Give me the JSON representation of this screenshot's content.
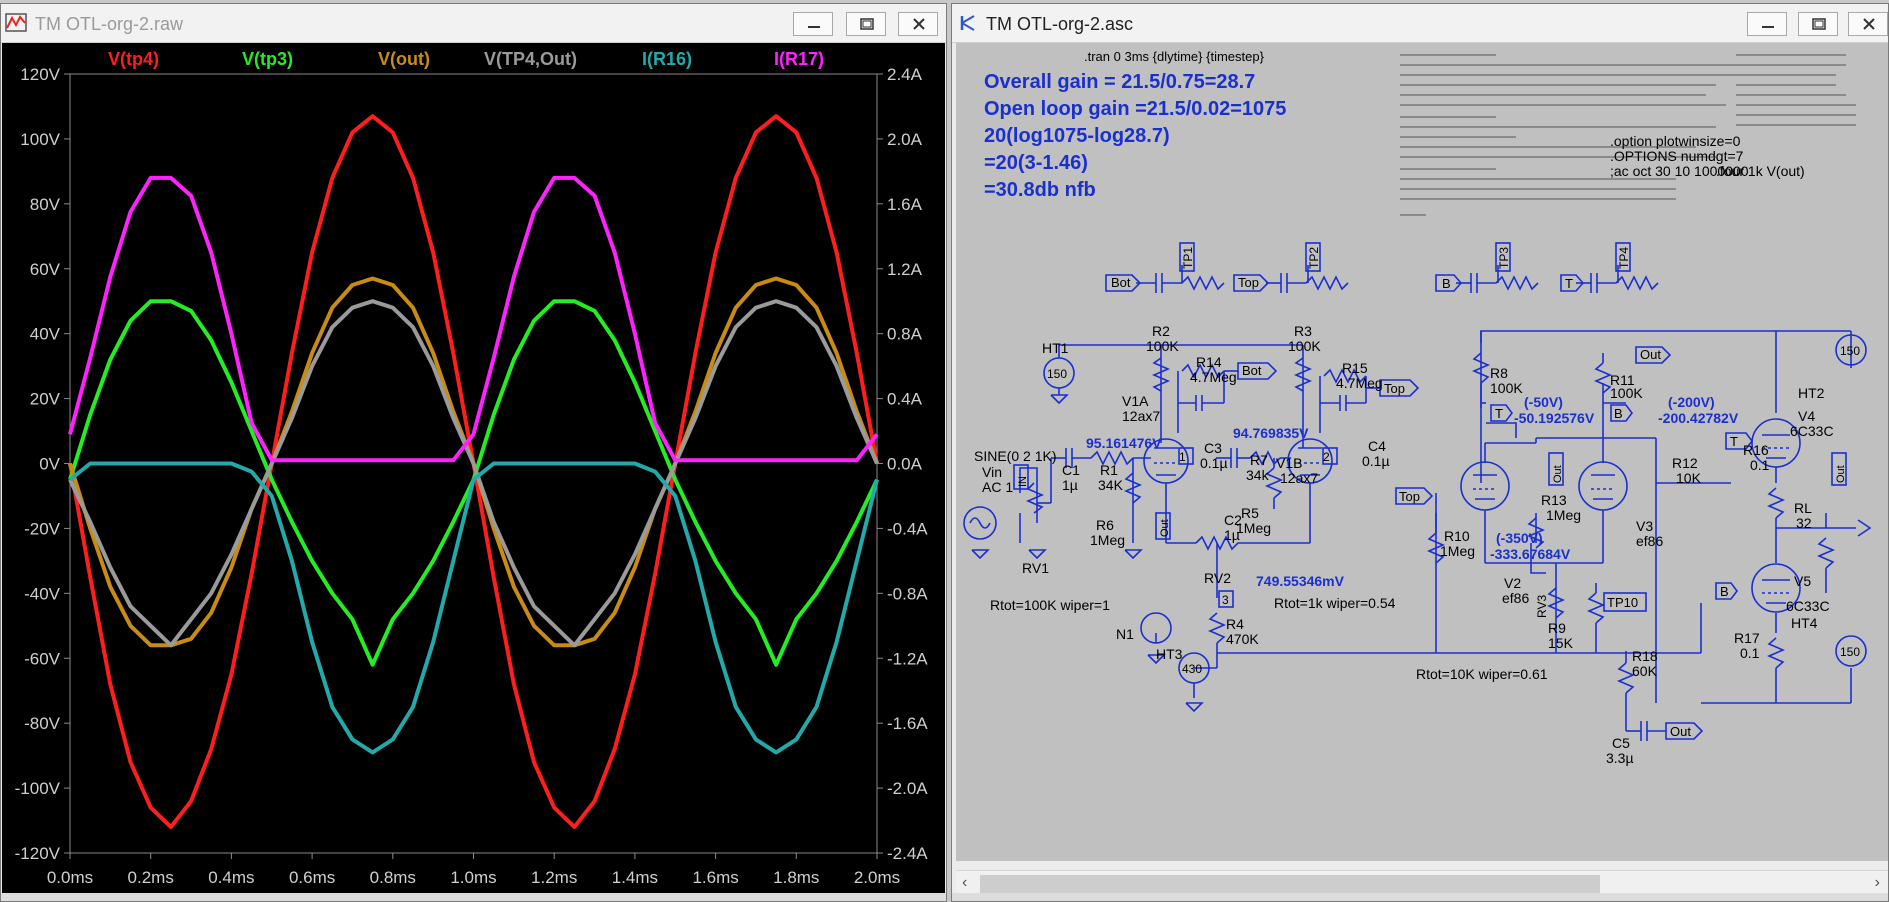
{
  "plot_window": {
    "title": "TM OTL-org-2.raw",
    "legend": [
      {
        "label": "V(tp4)",
        "color": "#ff1e1e"
      },
      {
        "label": "V(tp3)",
        "color": "#22ee22"
      },
      {
        "label": "V(out)",
        "color": "#c98c12"
      },
      {
        "label": "V(TP4,Out)",
        "color": "#9a9a9a"
      },
      {
        "label": "I(R16)",
        "color": "#22aaaa"
      },
      {
        "label": "I(R17)",
        "color": "#ff22ff"
      }
    ]
  },
  "chart_data": {
    "type": "line",
    "title": "",
    "xlabel": "",
    "ylabel": "",
    "xlim": [
      0,
      2.0
    ],
    "ylim": [
      -120,
      120
    ],
    "y2lim": [
      -2.4,
      2.4
    ],
    "grid": false,
    "legend_position": "top",
    "x_ticks": [
      "0.0ms",
      "0.2ms",
      "0.4ms",
      "0.6ms",
      "0.8ms",
      "1.0ms",
      "1.2ms",
      "1.4ms",
      "1.6ms",
      "1.8ms",
      "2.0ms"
    ],
    "y_ticks": [
      "120V",
      "100V",
      "80V",
      "60V",
      "40V",
      "20V",
      "0V",
      "-20V",
      "-40V",
      "-60V",
      "-80V",
      "-100V",
      "-120V"
    ],
    "y2_ticks": [
      "2.4A",
      "2.0A",
      "1.6A",
      "1.2A",
      "0.8A",
      "0.4A",
      "0.0A",
      "-0.4A",
      "-0.8A",
      "-1.2A",
      "-1.6A",
      "-2.0A",
      "-2.4A"
    ],
    "x": [
      0,
      0.05,
      0.1,
      0.15,
      0.2,
      0.25,
      0.3,
      0.35,
      0.4,
      0.45,
      0.5,
      0.55,
      0.6,
      0.65,
      0.7,
      0.75,
      0.8,
      0.85,
      0.9,
      0.95,
      1.0,
      1.05,
      1.1,
      1.15,
      1.2,
      1.25,
      1.3,
      1.35,
      1.4,
      1.45,
      1.5,
      1.55,
      1.6,
      1.65,
      1.7,
      1.75,
      1.8,
      1.85,
      1.9,
      1.95,
      2.0
    ],
    "series": [
      {
        "name": "V(tp4)",
        "axis": "left",
        "color": "#ff1e1e",
        "values": [
          0,
          -35,
          -68,
          -92,
          -106,
          -112,
          -104,
          -88,
          -65,
          -34,
          0,
          34,
          65,
          88,
          102,
          107,
          102,
          88,
          65,
          34,
          0,
          -35,
          -68,
          -92,
          -106,
          -112,
          -104,
          -88,
          -65,
          -34,
          0,
          34,
          65,
          88,
          102,
          107,
          102,
          88,
          65,
          34,
          0
        ]
      },
      {
        "name": "V(tp3)",
        "axis": "left",
        "color": "#22ee22",
        "values": [
          -5,
          15,
          32,
          44,
          50,
          50,
          47,
          38,
          25,
          10,
          -5,
          -18,
          -30,
          -40,
          -48,
          -62,
          -48,
          -40,
          -30,
          -18,
          -5,
          15,
          32,
          44,
          50,
          50,
          47,
          38,
          25,
          10,
          -5,
          -18,
          -30,
          -40,
          -48,
          -62,
          -48,
          -40,
          -30,
          -18,
          -5
        ]
      },
      {
        "name": "V(out)",
        "axis": "left",
        "color": "#c98c12",
        "values": [
          0,
          -20,
          -38,
          -50,
          -56,
          -56,
          -54,
          -46,
          -32,
          -14,
          0,
          16,
          34,
          48,
          55,
          57,
          55,
          48,
          34,
          16,
          0,
          -20,
          -38,
          -50,
          -56,
          -56,
          -54,
          -46,
          -32,
          -14,
          0,
          16,
          34,
          48,
          55,
          57,
          55,
          48,
          34,
          16,
          0
        ]
      },
      {
        "name": "V(TP4,Out)",
        "axis": "left",
        "color": "#9a9a9a",
        "values": [
          -5,
          -18,
          -32,
          -44,
          -50,
          -56,
          -48,
          -40,
          -28,
          -14,
          0,
          14,
          30,
          42,
          48,
          50,
          48,
          42,
          30,
          14,
          0,
          -18,
          -32,
          -44,
          -50,
          -56,
          -48,
          -40,
          -28,
          -14,
          0,
          14,
          30,
          42,
          48,
          50,
          48,
          42,
          30,
          14,
          0
        ]
      },
      {
        "name": "I(R16)",
        "axis": "right",
        "color": "#22aaaa",
        "values": [
          -0.1,
          0,
          0,
          0,
          0,
          0,
          0,
          0,
          0,
          -0.05,
          -0.2,
          -0.6,
          -1.1,
          -1.5,
          -1.7,
          -1.78,
          -1.7,
          -1.5,
          -1.1,
          -0.6,
          -0.1,
          0,
          0,
          0,
          0,
          0,
          0,
          0,
          0,
          -0.05,
          -0.2,
          -0.6,
          -1.1,
          -1.5,
          -1.7,
          -1.78,
          -1.7,
          -1.5,
          -1.1,
          -0.6,
          -0.1
        ]
      },
      {
        "name": "I(R17)",
        "axis": "right",
        "color": "#ff22ff",
        "values": [
          0.18,
          0.65,
          1.15,
          1.55,
          1.76,
          1.76,
          1.65,
          1.3,
          0.8,
          0.25,
          0.02,
          0.02,
          0.02,
          0.02,
          0.02,
          0.02,
          0.02,
          0.02,
          0.02,
          0.02,
          0.18,
          0.65,
          1.15,
          1.55,
          1.76,
          1.76,
          1.65,
          1.3,
          0.8,
          0.25,
          0.02,
          0.02,
          0.02,
          0.02,
          0.02,
          0.02,
          0.02,
          0.02,
          0.02,
          0.02,
          0.18
        ]
      }
    ]
  },
  "schematic_window": {
    "title": "TM OTL-org-2.asc",
    "directive": ".tran 0 3ms {dlytime} {timestep}",
    "notes": [
      "Overall gain = 21.5/0.75=28.7",
      "Open loop gain =21.5/0.02=1075",
      "20(log1075-log28.7)",
      "=20(3-1.46)",
      "=30.8db nfb"
    ],
    "option_lines": [
      ".option plotwinsize=0",
      ".OPTIONS numdgt=7",
      ";ac oct 30 10 1000000",
      ".four 1k V(out)"
    ],
    "labels": {
      "bot": "Bot",
      "top": "Top",
      "b": "B",
      "t": "T",
      "out": "Out",
      "tp1": "TP1",
      "tp2": "TP2",
      "tp3": "TP3",
      "tp4": "TP4",
      "tp10": "TP10",
      "ht1": "HT1",
      "ht2": "HT2",
      "ht3": "HT3",
      "ht4": "HT4",
      "v150a": "150",
      "v150b": "150",
      "v150c": "150",
      "v430": "430",
      "r2": "R2",
      "r2v": "100K",
      "r3": "R3",
      "r3v": "100K",
      "r14": "R14",
      "r14v": "4.7Meg",
      "r15": "R15",
      "r15v": "4.7Meg",
      "v1a": "V1A",
      "v1av": "12ax7",
      "v1b": "V1B",
      "v1bv": "12ax7",
      "c3": "C3",
      "c3v": "0.1µ",
      "c4": "C4",
      "c4v": "0.1µ",
      "r7": "R7",
      "r7v": "34k",
      "r5": "R5",
      "r5v": "1Meg",
      "c1": "C1",
      "c1v": "1µ",
      "r1": "R1",
      "r1v": "34K",
      "r6": "R6",
      "r6v": "1Meg",
      "c2": "C2",
      "c2v": "1µ",
      "rv1": "RV1",
      "rv2": "RV2",
      "rv3": "RV3",
      "r4": "R4",
      "r4v": "470K",
      "n1": "N1",
      "sine": "SINE(0 2 1K)",
      "vin": "Vin",
      "ac": "AC 1",
      "in": "IN",
      "rtot1": "Rtot=100K wiper=1",
      "rtot2": "Rtot=1k wiper=0.54",
      "rtot3": "Rtot=10K wiper=0.61",
      "v_node1": "95.161476V",
      "v_node2": "94.769835V",
      "v_node3": "749.55346mV",
      "n_1": "1",
      "n_2": "2",
      "n_3": "3",
      "r8": "R8",
      "r8v": "100K",
      "r11": "R11",
      "r11v": "100K",
      "m50": "(-50V)",
      "m50v": "-50.192576V",
      "m200": "(-200V)",
      "m200v": "-200.42782V",
      "m350": "(-350V)",
      "m350v": "-333.67684V",
      "r10": "R10",
      "r10v": "1Meg",
      "r13": "R13",
      "r13v": "1Meg",
      "v2": "V2",
      "v2v": "ef86",
      "v3": "V3",
      "v3v": "ef86",
      "r9": "R9",
      "r9v": "15K",
      "r12": "R12",
      "r12v": "10K",
      "r16": "R16",
      "r16v": "0.1",
      "r17": "R17",
      "r17v": "0.1",
      "rl": "RL",
      "rlv": "32",
      "v4": "V4",
      "v4v": "6C33C",
      "v5": "V5",
      "v5v": "6C33C",
      "r18": "R18",
      "r18v": "60K",
      "c5": "C5",
      "c5v": "3.3µ"
    }
  }
}
